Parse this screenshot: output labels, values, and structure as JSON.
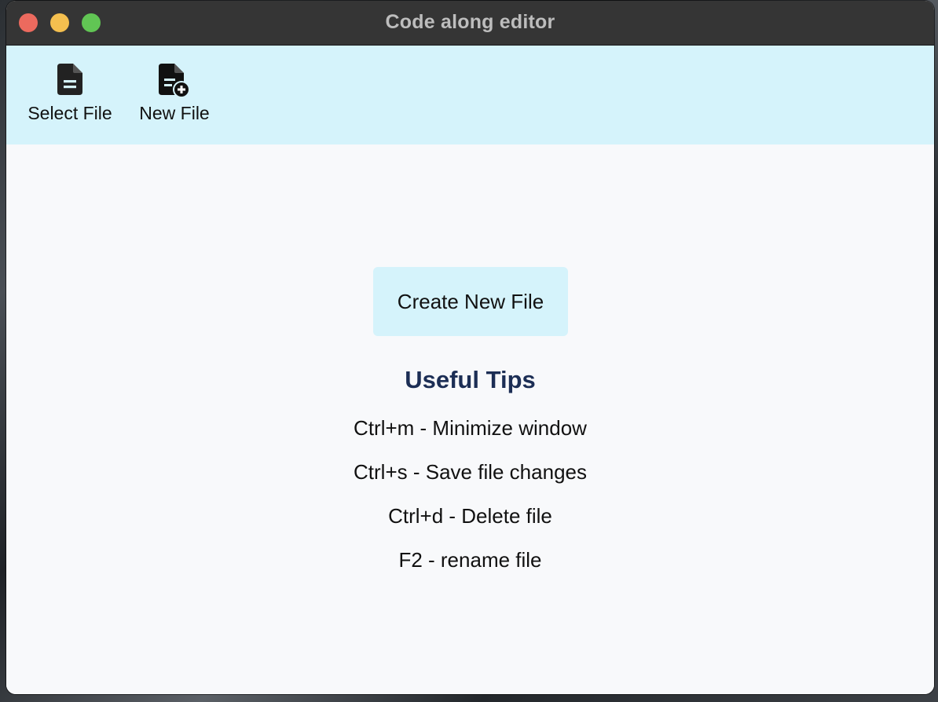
{
  "window": {
    "title": "Code along editor",
    "traffic_lights": {
      "close_color": "#ec6a5e",
      "minimize_color": "#f4bf4f",
      "maximize_color": "#61c554"
    }
  },
  "toolbar": {
    "background": "#d5f3fb",
    "buttons": [
      {
        "label": "Select File",
        "icon": "file-text-icon"
      },
      {
        "label": "New File",
        "icon": "file-plus-icon"
      }
    ]
  },
  "main": {
    "create_button_label": "Create New File",
    "tips_title": "Useful Tips",
    "tips_title_color": "#1c2e55",
    "tips": [
      "Ctrl+m - Minimize window",
      "Ctrl+s - Save file changes",
      "Ctrl+d - Delete file",
      "F2 - rename file"
    ]
  }
}
